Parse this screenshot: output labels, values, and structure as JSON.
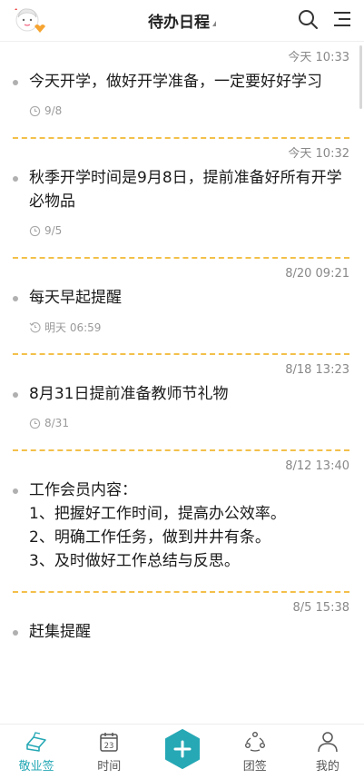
{
  "header": {
    "title": "待办日程",
    "icons": {
      "avatar": "avatar-girl-icon",
      "search": "search-icon",
      "menu": "menu-icon"
    }
  },
  "items": [
    {
      "time": "今天 10:33",
      "text": "今天开学，做好开学准备，一定要好好学习",
      "meta_icon": "clock-icon",
      "meta": "9/8"
    },
    {
      "time": "今天 10:32",
      "text": "秋季开学时间是9月8日，提前准备好所有开学必物品",
      "meta_icon": "clock-icon",
      "meta": "9/5"
    },
    {
      "time": "8/20 09:21",
      "text": "每天早起提醒",
      "meta_icon": "repeat-clock-icon",
      "meta": "明天 06:59"
    },
    {
      "time": "8/18 13:23",
      "text": "8月31日提前准备教师节礼物",
      "meta_icon": "clock-icon",
      "meta": "8/31"
    },
    {
      "time": "8/12 13:40",
      "text": "工作会员内容：\n1、把握好工作时间，提高办公效率。\n2、明确工作任务，做到井井有条。\n3、及时做好工作总结与反思。",
      "meta_icon": "",
      "meta": ""
    },
    {
      "time": "8/5 15:38",
      "text": "赶集提醒",
      "meta_icon": "",
      "meta": ""
    }
  ],
  "nav": [
    {
      "label": "敬业签",
      "icon": "note-icon",
      "active": true
    },
    {
      "label": "时间",
      "icon": "calendar-icon",
      "calendar_day": "23"
    },
    {
      "label": "",
      "icon": "add-icon"
    },
    {
      "label": "团签",
      "icon": "team-icon"
    },
    {
      "label": "我的",
      "icon": "user-icon"
    }
  ],
  "colors": {
    "accent": "#26a8b5",
    "divider": "#f3c04a",
    "muted": "#9a9a9a"
  }
}
